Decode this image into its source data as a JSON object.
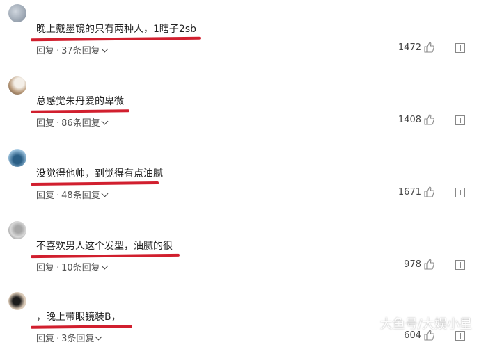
{
  "comments": [
    {
      "text": "晚上戴墨镜的只有两种人，1瞎子2sb",
      "reply_label": "回复",
      "replies_label": "37条回复",
      "likes": "1472"
    },
    {
      "text": "总感觉朱丹爱的卑微",
      "reply_label": "回复",
      "replies_label": "86条回复",
      "likes": "1408"
    },
    {
      "text": "没觉得他帅，到觉得有点油腻",
      "reply_label": "回复",
      "replies_label": "48条回复",
      "likes": "1671"
    },
    {
      "text": "不喜欢男人这个发型，油腻的很",
      "reply_label": "回复",
      "replies_label": "10条回复",
      "likes": "978"
    },
    {
      "text": "，晚上带眼镜装B，",
      "reply_label": "回复",
      "replies_label": "3条回复",
      "likes": "604"
    }
  ],
  "separator": "·",
  "icons": {
    "like": "thumbs-up-icon",
    "report": "report-icon",
    "expand": "chevron-down-icon"
  },
  "colors": {
    "underline": "#d11f2e"
  },
  "watermark": "大鱼号/大娱小星"
}
